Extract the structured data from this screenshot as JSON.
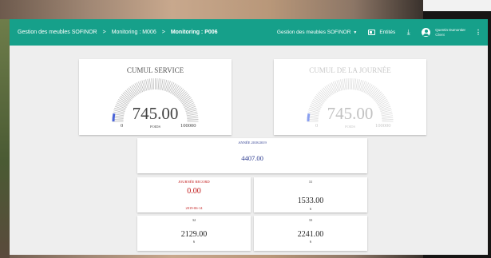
{
  "header": {
    "breadcrumbs": [
      {
        "label": "Gestion des meubles SOFINOR"
      },
      {
        "label": "Monitoring : M006"
      },
      {
        "label": "Monitoring : P006"
      }
    ],
    "separator": ">",
    "menu_label": "Gestion des meubles SOFINOR",
    "entities_label": "Entités",
    "user_name": "Quentin Dumontier",
    "user_role": "Client",
    "accent_color": "#16a08a"
  },
  "gauges": [
    {
      "title": "CUMUL SERVICE",
      "value": "745.00",
      "fraction": 0.007,
      "min": "0",
      "max": "100000",
      "unit": "POIDS"
    },
    {
      "title": "CUMUL DE LA JOURNÉE",
      "value": "745.00",
      "fraction": 0.007,
      "min": "0",
      "max": "100000",
      "unit": "POIDS"
    }
  ],
  "year_card": {
    "label": "ANNÉE 2018/2019",
    "value": "4407.00"
  },
  "record_card": {
    "label": "JOURNÉE RECORD",
    "value": "0.00",
    "date": "2019-06-14"
  },
  "tiles": [
    {
      "label": "31",
      "value": "1533.00",
      "sub": "6"
    },
    {
      "label": "32",
      "value": "2129.00",
      "sub": "6"
    },
    {
      "label": "33",
      "value": "2241.00",
      "sub": "6"
    }
  ]
}
